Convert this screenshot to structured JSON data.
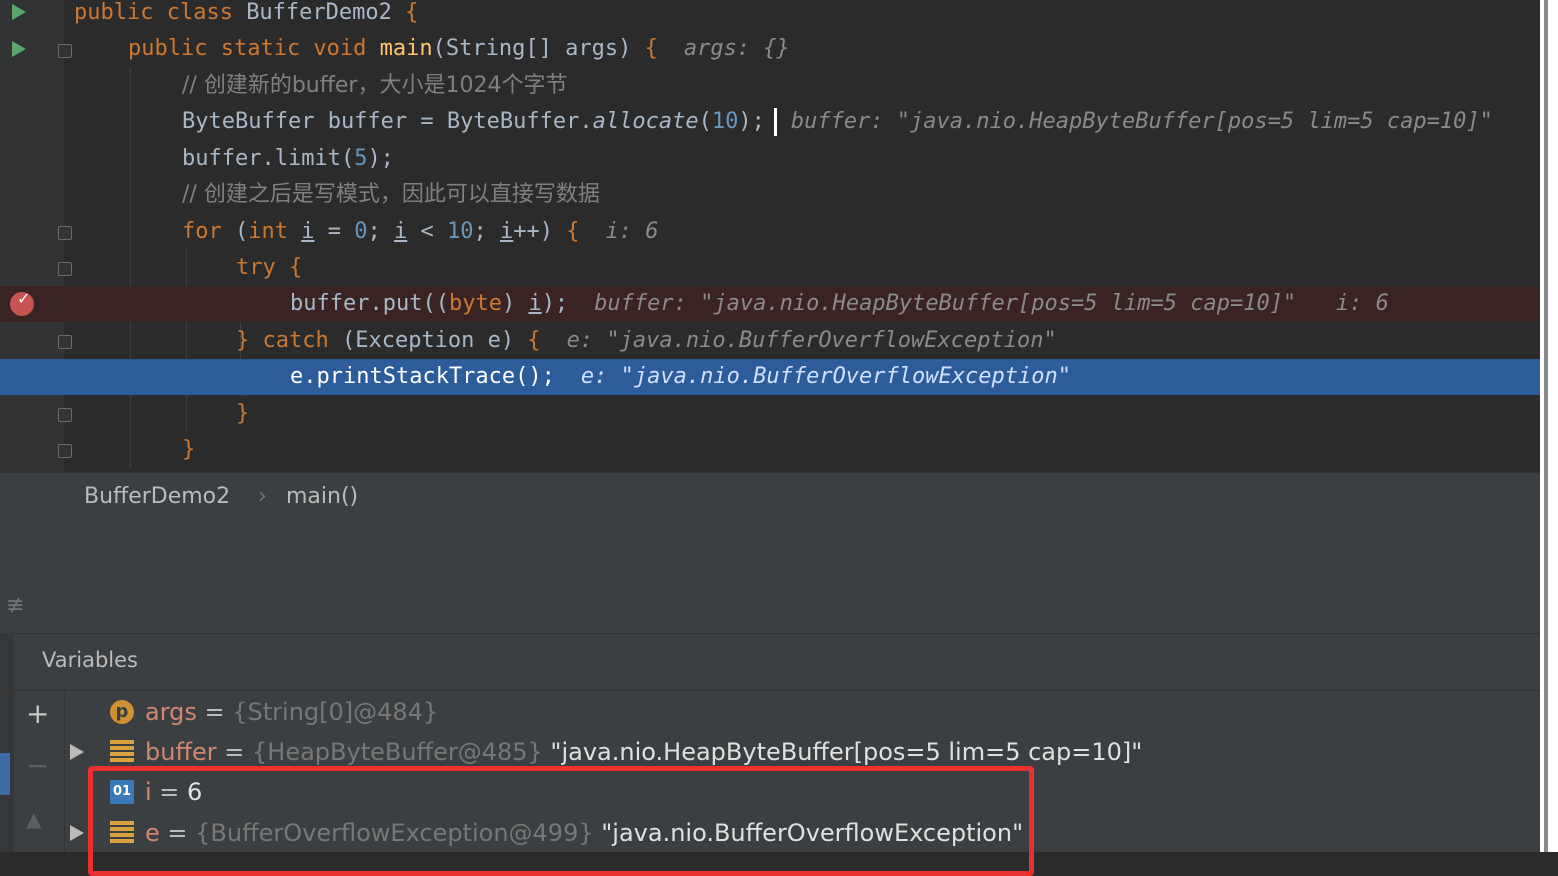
{
  "editor": {
    "lines": [
      {
        "parts": [
          [
            "kw",
            "public class "
          ],
          [
            "txt",
            "BufferDemo2 "
          ],
          [
            "kw",
            "{"
          ]
        ]
      },
      {
        "parts": [
          [
            "kw",
            "public static void "
          ],
          [
            "fn",
            "main"
          ],
          [
            "txt",
            "(String[] args) "
          ],
          [
            "kw",
            "{"
          ]
        ],
        "debug": "args: {}"
      },
      {
        "parts": [
          [
            "cm",
            "// 创建新的buffer，大小是1024个字节"
          ]
        ]
      },
      {
        "parts": [
          [
            "txt",
            "ByteBuffer buffer = ByteBuffer."
          ],
          [
            "it",
            "allocate"
          ],
          [
            "txt",
            "("
          ],
          [
            "num",
            "10"
          ],
          [
            "txt",
            ");"
          ]
        ],
        "debug": "buffer: \"java.nio.HeapByteBuffer[pos=5 lim=5 cap=10]\""
      },
      {
        "parts": [
          [
            "txt",
            "buffer.limit("
          ],
          [
            "num",
            "5"
          ],
          [
            "txt",
            ");"
          ]
        ]
      },
      {
        "parts": [
          [
            "cm",
            "// 创建之后是写模式，因此可以直接写数据"
          ]
        ]
      },
      {
        "parts": [
          [
            "kw",
            "for "
          ],
          [
            "txt",
            "("
          ],
          [
            "kw",
            "int "
          ],
          [
            "ul",
            "i"
          ],
          [
            "txt",
            " = "
          ],
          [
            "num",
            "0"
          ],
          [
            "txt",
            "; "
          ],
          [
            "ul",
            "i"
          ],
          [
            "txt",
            " < "
          ],
          [
            "num",
            "10"
          ],
          [
            "txt",
            "; "
          ],
          [
            "ul",
            "i"
          ],
          [
            "txt",
            "++) "
          ],
          [
            "kw",
            "{"
          ]
        ],
        "debug": "i: 6"
      },
      {
        "parts": [
          [
            "kw",
            "try "
          ],
          [
            "kw",
            "{"
          ]
        ]
      },
      {
        "parts": [
          [
            "txt",
            "buffer.put(("
          ],
          [
            "kw",
            "byte"
          ],
          [
            "txt",
            ") "
          ],
          [
            "ul",
            "i"
          ],
          [
            "txt",
            ");"
          ]
        ],
        "debug": "buffer: \"java.nio.HeapByteBuffer[pos=5 lim=5 cap=10]\"   i: 6"
      },
      {
        "parts": [
          [
            "kw",
            "} catch "
          ],
          [
            "txt",
            "(Exception e) "
          ],
          [
            "kw",
            "{"
          ]
        ],
        "debug": "e: \"java.nio.BufferOverflowException\""
      },
      {
        "parts": [
          [
            "txt",
            "e.printStackTrace();"
          ]
        ],
        "debug": "e: \"java.nio.BufferOverflowException\""
      },
      {
        "parts": [
          [
            "kw",
            "}"
          ]
        ]
      },
      {
        "parts": [
          [
            "kw",
            "}"
          ]
        ]
      }
    ]
  },
  "breadcrumb": {
    "class_name": "BufferDemo2",
    "separator": "›",
    "method_name": "main()"
  },
  "variables": {
    "title": "Variables",
    "add_symbol": "+",
    "remove_symbol": "−",
    "up_symbol": "▲",
    "rows": [
      {
        "icon": "p",
        "icon_name": "parameter-icon",
        "name": "args",
        "eq": " = ",
        "ref": "{String[0]@484}",
        "value": ""
      },
      {
        "icon": "f",
        "icon_name": "field-icon",
        "name": "buffer",
        "eq": " = ",
        "ref": "{HeapByteBuffer@485}",
        "value": " \"java.nio.HeapByteBuffer[pos=5 lim=5 cap=10]\""
      },
      {
        "icon": "01",
        "icon_name": "primitive-icon",
        "name": "i",
        "eq": " = ",
        "ref": "",
        "value": "6"
      },
      {
        "icon": "f",
        "icon_name": "field-icon",
        "name": "e",
        "eq": " = ",
        "ref": "{BufferOverflowException@499}",
        "value": " \"java.nio.BufferOverflowException\""
      }
    ]
  },
  "colors": {
    "keyword": "#cc7832",
    "number": "#6897bb",
    "comment": "#808080",
    "exec_line": "#2d5c9b",
    "breakpoint": "#c75450",
    "highlight_box": "#e8302f"
  }
}
